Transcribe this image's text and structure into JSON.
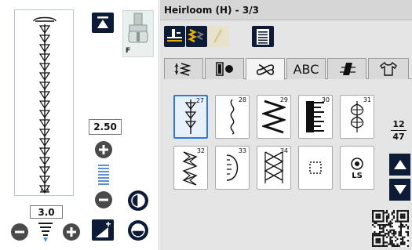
{
  "header": {
    "title": "Heirloom (H) - 3/3"
  },
  "left_panel": {
    "presser_foot_letter": "F",
    "stitch_width_value": "2.50",
    "stitch_length_value": "3.0"
  },
  "tabs": [
    {
      "name": "tab-utility-stitches",
      "icon": "utility-stitch-icon",
      "label": ""
    },
    {
      "name": "tab-buttonholes",
      "icon": "buttonhole-icon",
      "label": ""
    },
    {
      "name": "tab-decorative-stitches",
      "icon": "decorative-knot-icon",
      "label": ""
    },
    {
      "name": "tab-alphabets",
      "icon": "alphabet-icon",
      "label": "ABC"
    },
    {
      "name": "tab-quilt-stitches",
      "icon": "quilt-stitch-icon",
      "label": ""
    },
    {
      "name": "tab-garment-stitches",
      "icon": "shirt-icon",
      "label": ""
    }
  ],
  "active_tab": "tab-decorative-stitches",
  "stitches": [
    {
      "number": "27",
      "icon": "triple-arrow-stitch-icon",
      "selected": true
    },
    {
      "number": "28",
      "icon": "wavy-stitch-icon",
      "selected": false
    },
    {
      "number": "29",
      "icon": "zigzag-stitch-icon",
      "selected": false
    },
    {
      "number": "30",
      "icon": "blanket-stitch-icon",
      "selected": false
    },
    {
      "number": "31",
      "icon": "leaf-stitch-icon",
      "selected": false
    },
    {
      "number": "32",
      "icon": "feather-stitch-icon",
      "selected": false
    },
    {
      "number": "33",
      "icon": "scallop-stitch-icon",
      "selected": false
    },
    {
      "number": "34",
      "icon": "cross-stitch-icon",
      "selected": false
    },
    {
      "number": "",
      "icon": "square-stitch-icon",
      "selected": false
    },
    {
      "number": "",
      "icon": "ls-stitch-icon",
      "selected": false,
      "label": "LS"
    }
  ],
  "pagination": {
    "current": "12",
    "total": "47"
  },
  "colors": {
    "accent": "#2f7bd1",
    "dark_button": "#0e1b36",
    "icon_yellow": "#e8b300",
    "panel_bg": "#e5e5e5"
  }
}
